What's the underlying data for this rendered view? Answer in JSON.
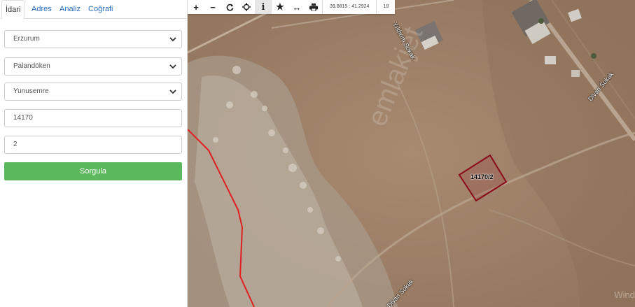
{
  "tabs": [
    {
      "label": "İdari",
      "active": true
    },
    {
      "label": "Adres"
    },
    {
      "label": "Analiz"
    },
    {
      "label": "Coğrafi"
    }
  ],
  "form": {
    "il": "Erzurum",
    "ilce": "Palandöken",
    "mahalle": "Yunusemre",
    "ada": "14170",
    "parsel": "2",
    "submit_label": "Sorgula"
  },
  "map": {
    "toolbar": {
      "tools": [
        "zoom-in",
        "zoom-out",
        "refresh",
        "locate",
        "info",
        "favorite",
        "measure",
        "print"
      ],
      "coordinates": "39.8815 : 41.2924",
      "zoom": "18"
    },
    "streets": [
      "Yıldırım Sokak",
      "Divan Sokak",
      "Divan Sokak"
    ],
    "parcel_label": "14170/2",
    "watermark": "emlakjet",
    "os_watermark": "Wind"
  },
  "colors": {
    "accent": "#2a6ebb",
    "submit": "#5cb85c",
    "parcel_outline": "#8b0a1a",
    "boundary": "#e02020"
  }
}
